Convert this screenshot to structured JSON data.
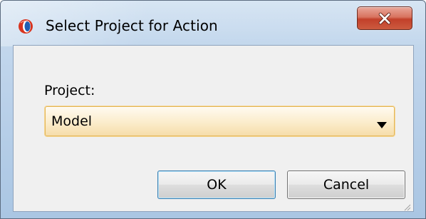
{
  "dialog": {
    "title": "Select Project for Action",
    "app_icon": "oracle-jdeveloper-app-icon",
    "close_icon": "close-x-icon"
  },
  "form": {
    "project_label": "Project:",
    "project_select": {
      "selected_value": "Model",
      "arrow_icon": "dropdown-arrow-icon"
    }
  },
  "buttons": {
    "ok_label": "OK",
    "cancel_label": "Cancel"
  },
  "colors": {
    "title_bar": "#bcd2ea",
    "close_button": "#c2402a",
    "content_background": "#f0f0f0",
    "select_highlight_border": "#e3b75a",
    "default_button_border": "#3c7fb1"
  }
}
